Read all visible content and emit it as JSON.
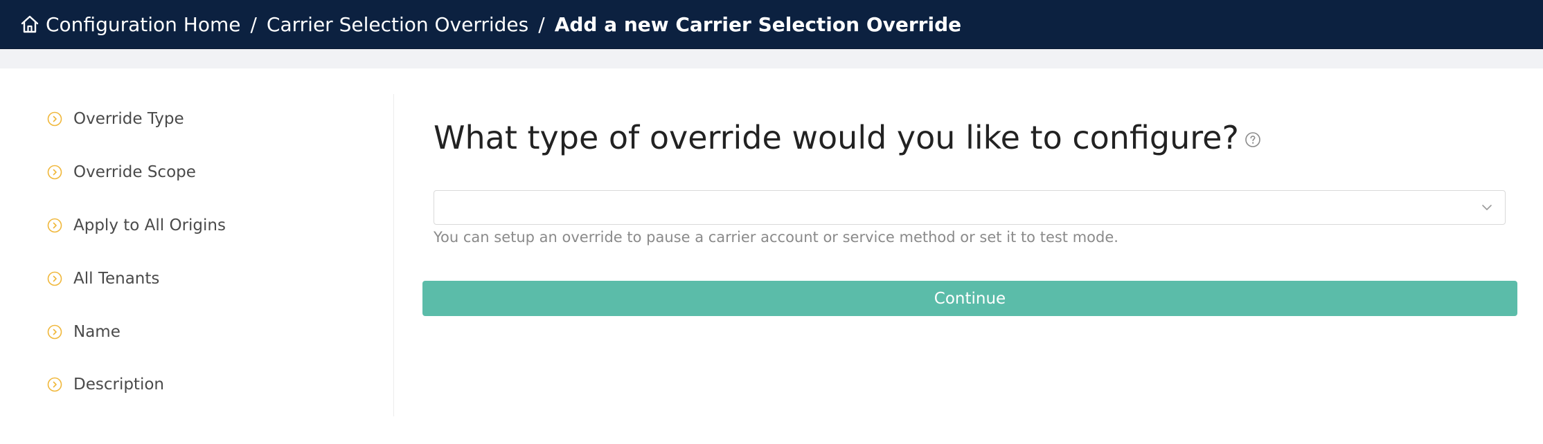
{
  "breadcrumb": {
    "items": [
      "Configuration Home",
      "Carrier Selection Overrides"
    ],
    "current": "Add a new Carrier Selection Override",
    "separator": "/"
  },
  "steps": [
    {
      "label": "Override Type",
      "icon": "chevron-circle-right-icon"
    },
    {
      "label": "Override Scope",
      "icon": "chevron-circle-right-icon"
    },
    {
      "label": "Apply to All Origins",
      "icon": "chevron-circle-right-icon"
    },
    {
      "label": "All Tenants",
      "icon": "chevron-circle-right-icon"
    },
    {
      "label": "Name",
      "icon": "chevron-circle-right-icon"
    },
    {
      "label": "Description",
      "icon": "chevron-circle-right-icon"
    }
  ],
  "form": {
    "question": "What type of override would you like to configure?",
    "select_value": "",
    "hint": "You can setup an override to pause a carrier account or service method or set it to test mode.",
    "continue_label": "Continue"
  },
  "colors": {
    "header_bg": "#0c2140",
    "accent": "#5bbca9",
    "step_icon": "#f0b73a"
  }
}
